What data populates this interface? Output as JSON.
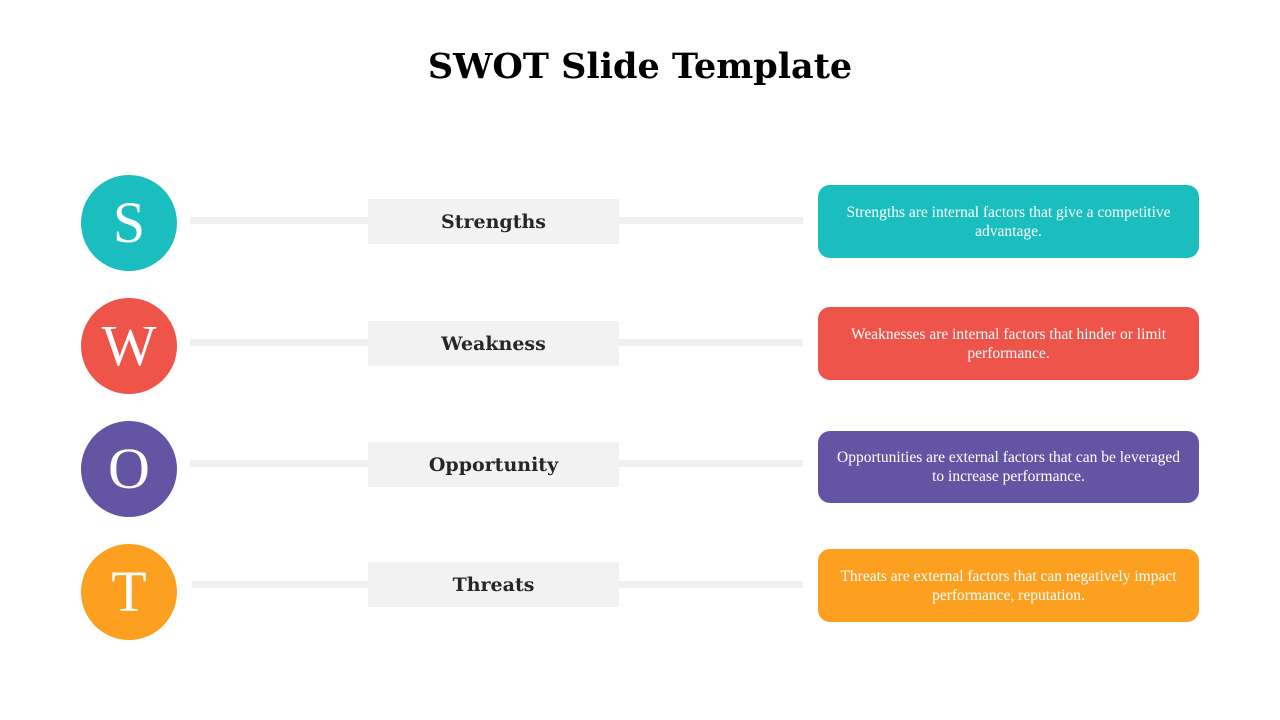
{
  "title": "SWOT Slide Template",
  "items": [
    {
      "letter": "S",
      "label": "Strengths",
      "description": "Strengths are internal factors that give a competitive advantage.",
      "color": "#1abebe"
    },
    {
      "letter": "W",
      "label": "Weakness",
      "description": "Weaknesses are internal factors that hinder or limit performance.",
      "color": "#ef544b"
    },
    {
      "letter": "O",
      "label": "Opportunity",
      "description": "Opportunities are external factors that can be leveraged to increase performance.",
      "color": "#6454a4"
    },
    {
      "letter": "T",
      "label": "Threats",
      "description": "Threats are external factors that can negatively impact performance, reputation.",
      "color": "#fda020"
    }
  ]
}
